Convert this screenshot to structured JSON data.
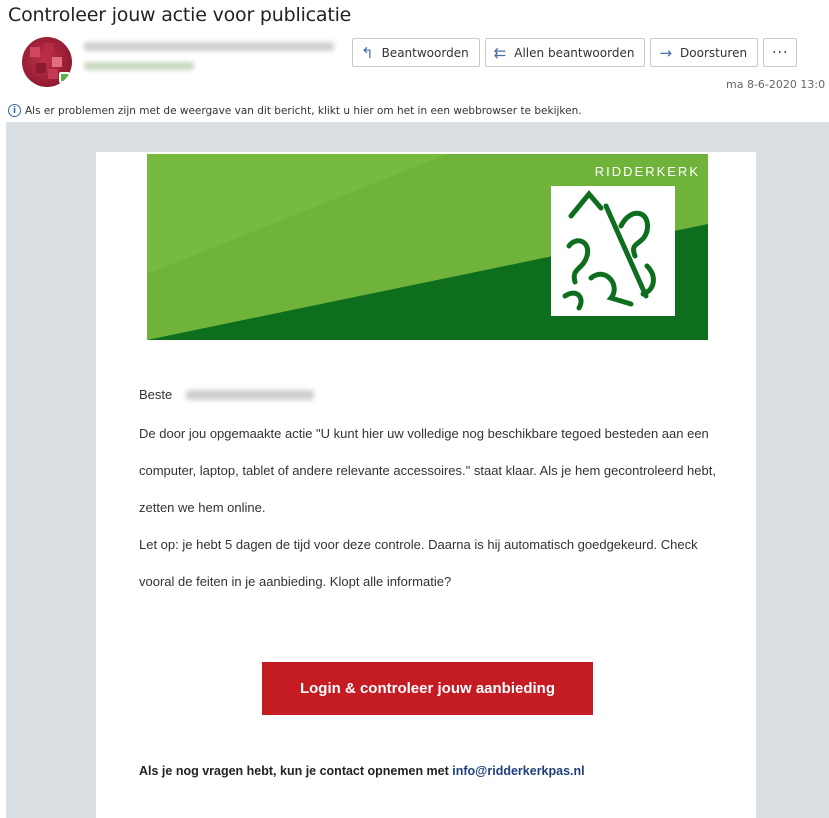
{
  "subject": "Controleer jouw actie voor publicatie",
  "actions": [
    {
      "label": "Beantwoorden",
      "icon": "reply-icon",
      "glyph": "↰"
    },
    {
      "label": "Allen beantwoorden",
      "icon": "reply-all-icon",
      "glyph": "⇇"
    },
    {
      "label": "Doorsturen",
      "icon": "forward-icon",
      "glyph": "→"
    }
  ],
  "more_glyph": "···",
  "date": "ma 8-6-2020 13:0",
  "infobar_text": "Als er problemen zijn met de weergave van dit bericht, klikt u hier om het in een webbrowser te bekijken.",
  "banner": {
    "brand": "RIDDERKERK"
  },
  "greeting": "Beste",
  "paragraph1": "De door jou opgemaakte actie \"U kunt hier uw volledige nog beschikbare tegoed besteden aan een computer, laptop, tablet of andere relevante accessoires.\" staat klaar. Als je hem gecontroleerd hebt, zetten we hem online.",
  "paragraph2": "Let op: je hebt 5 dagen de tijd voor deze controle. Daarna is hij automatisch goedgekeurd. Check vooral de feiten in je aanbieding. Klopt alle informatie?",
  "cta_label": "Login & controleer jouw aanbieding",
  "footer_text": "Als je nog vragen hebt, kun je contact opnemen met",
  "footer_email": "info@ridderkerkpas.nl",
  "colors": {
    "banner_dark": "#0d6e1e",
    "banner_light": "#74b83a",
    "cta": "#c51b23",
    "link": "#1f3f7a",
    "canvas": "#d9dfe3"
  }
}
